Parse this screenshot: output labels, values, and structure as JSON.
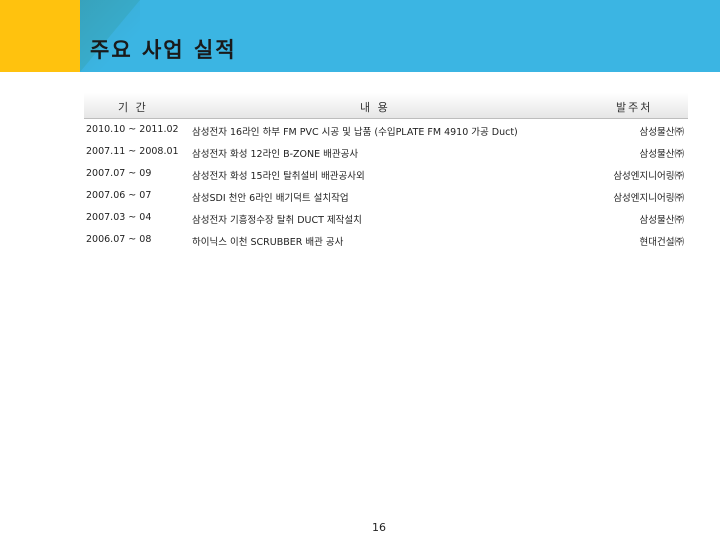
{
  "slide": {
    "title": "주요 사업 실적",
    "page_number": "16",
    "colors": {
      "title_band": "#3bb5e3",
      "accent_yellow": "#ffc20e",
      "accent_teal": "#34a6b8"
    }
  },
  "table": {
    "headers": {
      "period": "기 간",
      "content": "내 용",
      "client": "발주처"
    },
    "rows": [
      {
        "period": "2010.10 ~ 2011.02",
        "content": "삼성전자 16라인 하부 FM PVC 시공 및 납품 (수입PLATE FM 4910 가공 Duct)",
        "client": "삼성물산㈜"
      },
      {
        "period": "2007.11 ~ 2008.01",
        "content": "삼성전자 화성 12라인 B-ZONE 배관공사",
        "client": "삼성물산㈜"
      },
      {
        "period": "2007.07 ~ 09",
        "content": "삼성전자 화성 15라인 탈취설비 배관공사외",
        "client": "삼성엔지니어링㈜"
      },
      {
        "period": "2007.06 ~ 07",
        "content": "삼성SDI 천안 6라인 배기덕트 설치작업",
        "client": "삼성엔지니어링㈜"
      },
      {
        "period": "2007.03 ~ 04",
        "content": "삼성전자 기흥정수장 탈취 DUCT 제작설치",
        "client": "삼성물산㈜"
      },
      {
        "period": "2006.07 ~ 08",
        "content": "하이닉스 이천 SCRUBBER 배관 공사",
        "client": "현대건설㈜"
      }
    ]
  }
}
